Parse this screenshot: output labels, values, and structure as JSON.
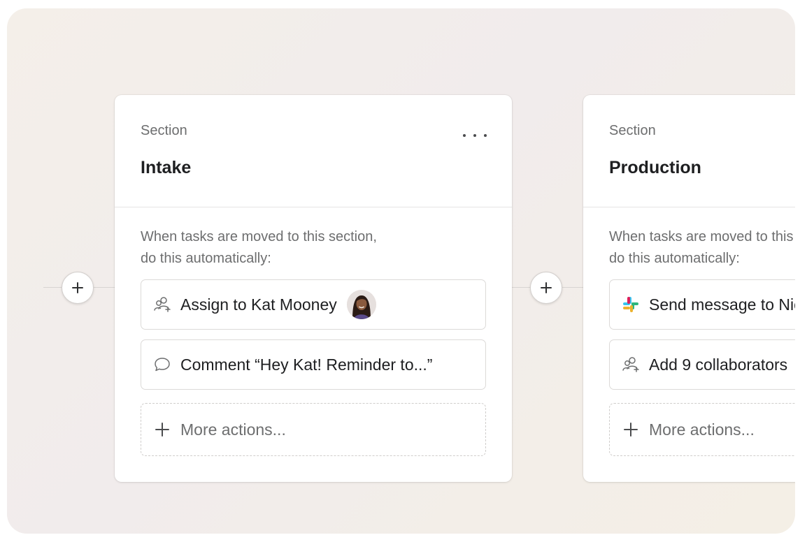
{
  "nodes": [
    {
      "icon": "plus-icon"
    },
    {
      "icon": "plus-icon"
    }
  ],
  "sections": [
    {
      "label": "Section",
      "title": "Intake",
      "description_line1": "When tasks are moved to this section,",
      "description_line2": "do this automatically:",
      "actions": [
        {
          "icon": "add-collaborator-icon",
          "text": "Assign to Kat Mooney",
          "avatar": "kat-mooney-avatar"
        },
        {
          "icon": "comment-icon",
          "text": "Comment “Hey Kat! Reminder to...”"
        }
      ],
      "more_actions": "More actions..."
    },
    {
      "label": "Section",
      "title": "Production",
      "description_line1": "When tasks are moved to this section,",
      "description_line2": "do this automatically:",
      "actions": [
        {
          "icon": "slack-icon",
          "text": "Send message to Nick"
        },
        {
          "icon": "add-collaborator-icon",
          "text": "Add 9 collaborators"
        }
      ],
      "more_actions": "More actions..."
    }
  ],
  "colors": {
    "slack_blue": "#36C5F0",
    "slack_green": "#2EB67D",
    "slack_yellow": "#ECB22E",
    "slack_red": "#E01E5A"
  }
}
